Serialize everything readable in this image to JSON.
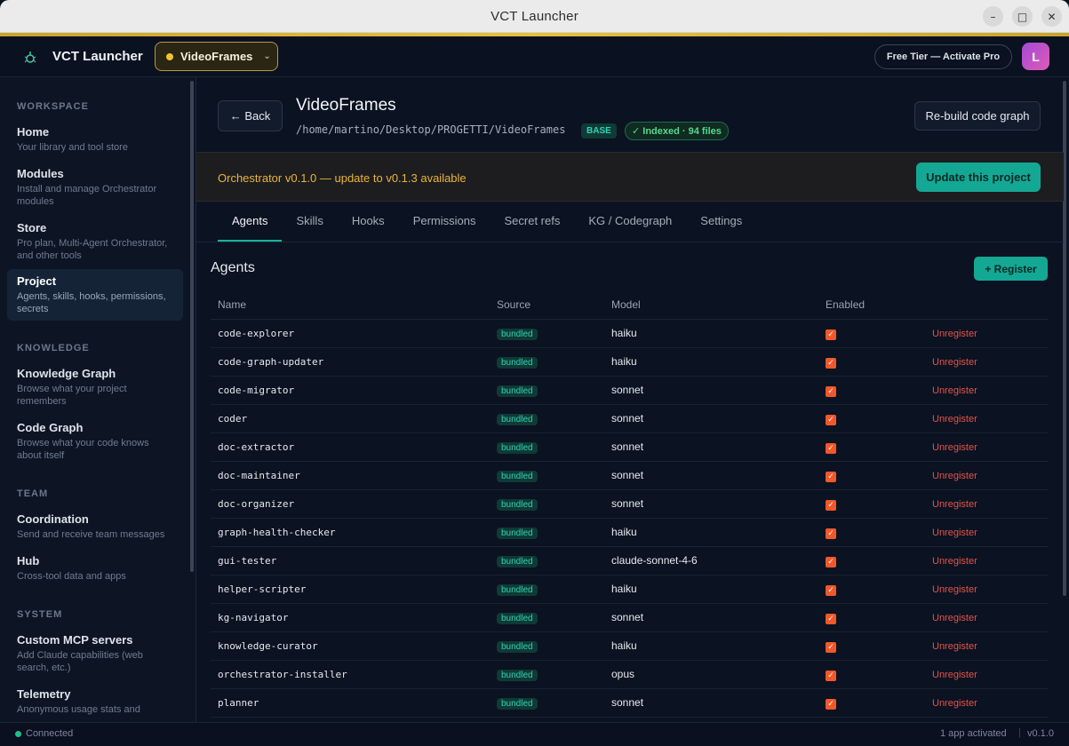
{
  "window": {
    "title": "VCT Launcher"
  },
  "header": {
    "brand": "VCT Launcher",
    "project_selector": "VideoFrames",
    "tier_button": "Free Tier — Activate Pro",
    "avatar_initial": "L"
  },
  "sidebar": {
    "sections": [
      "WORKSPACE",
      "KNOWLEDGE",
      "TEAM",
      "SYSTEM"
    ],
    "items": [
      {
        "title": "Home",
        "desc": "Your library and tool store"
      },
      {
        "title": "Modules",
        "desc": "Install and manage Orchestrator modules"
      },
      {
        "title": "Store",
        "desc": "Pro plan, Multi-Agent Orchestrator, and other tools"
      },
      {
        "title": "Project",
        "desc": "Agents, skills, hooks, permissions, secrets"
      },
      {
        "title": "Knowledge Graph",
        "desc": "Browse what your project remembers"
      },
      {
        "title": "Code Graph",
        "desc": "Browse what your code knows about itself"
      },
      {
        "title": "Coordination",
        "desc": "Send and receive team messages"
      },
      {
        "title": "Hub",
        "desc": "Cross-tool data and apps"
      },
      {
        "title": "Custom MCP servers",
        "desc": "Add Claude capabilities (web search, etc.)"
      },
      {
        "title": "Telemetry",
        "desc": "Anonymous usage stats and"
      }
    ],
    "active": "Project"
  },
  "project": {
    "back": "← Back",
    "title": "VideoFrames",
    "path": "/home/martino/Desktop/PROGETTI/VideoFrames",
    "badge_base": "BASE",
    "badge_indexed": "✓ Indexed · 94 files",
    "rebuild": "Re-build code graph"
  },
  "update_banner": {
    "text": "Orchestrator v0.1.0 — update to v0.1.3 available",
    "button": "Update this project"
  },
  "tabs": [
    "Agents",
    "Skills",
    "Hooks",
    "Permissions",
    "Secret refs",
    "KG / Codegraph",
    "Settings"
  ],
  "active_tab": "Agents",
  "agents": {
    "title": "Agents",
    "register": "+ Register",
    "columns": [
      "Name",
      "Source",
      "Model",
      "Enabled",
      ""
    ],
    "action_label": "Unregister",
    "rows": [
      {
        "name": "code-explorer",
        "source": "bundled",
        "model": "haiku",
        "enabled": true
      },
      {
        "name": "code-graph-updater",
        "source": "bundled",
        "model": "haiku",
        "enabled": true
      },
      {
        "name": "code-migrator",
        "source": "bundled",
        "model": "sonnet",
        "enabled": true
      },
      {
        "name": "coder",
        "source": "bundled",
        "model": "sonnet",
        "enabled": true
      },
      {
        "name": "doc-extractor",
        "source": "bundled",
        "model": "sonnet",
        "enabled": true
      },
      {
        "name": "doc-maintainer",
        "source": "bundled",
        "model": "sonnet",
        "enabled": true
      },
      {
        "name": "doc-organizer",
        "source": "bundled",
        "model": "sonnet",
        "enabled": true
      },
      {
        "name": "graph-health-checker",
        "source": "bundled",
        "model": "haiku",
        "enabled": true
      },
      {
        "name": "gui-tester",
        "source": "bundled",
        "model": "claude-sonnet-4-6",
        "enabled": true
      },
      {
        "name": "helper-scripter",
        "source": "bundled",
        "model": "haiku",
        "enabled": true
      },
      {
        "name": "kg-navigator",
        "source": "bundled",
        "model": "sonnet",
        "enabled": true
      },
      {
        "name": "knowledge-curator",
        "source": "bundled",
        "model": "haiku",
        "enabled": true
      },
      {
        "name": "orchestrator-installer",
        "source": "bundled",
        "model": "opus",
        "enabled": true
      },
      {
        "name": "planner",
        "source": "bundled",
        "model": "sonnet",
        "enabled": true
      }
    ]
  },
  "statusbar": {
    "left": "Connected",
    "right": "1 app activated",
    "separator": "|",
    "version": "v0.1.0"
  },
  "icons": {
    "minimize": "minimize-icon",
    "maximize": "maximize-icon",
    "close": "close-icon",
    "logo": "bug-logo-icon"
  },
  "colors": {
    "accent": "#14a894",
    "warning": "#eab43d",
    "danger": "#e2544a",
    "checkbox": "#f0582b"
  }
}
